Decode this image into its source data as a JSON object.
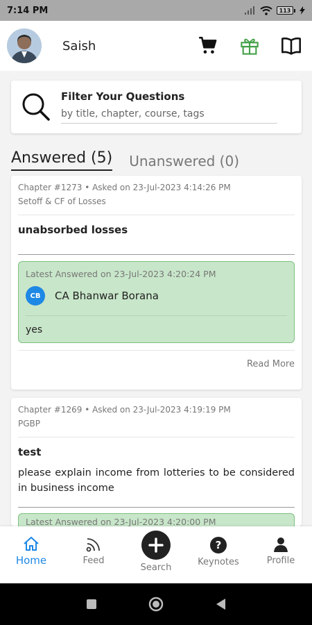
{
  "status": {
    "time": "7:14 PM",
    "battery": "113"
  },
  "header": {
    "username": "Saish"
  },
  "filter": {
    "title": "Filter Your Questions",
    "placeholder": "by title, chapter, course, tags"
  },
  "tabs": {
    "answered": "Answered (5)",
    "unanswered": "Unanswered (0)"
  },
  "questions": [
    {
      "meta": "Chapter #1273 • Asked on 23-Jul-2023 4:14:26 PM",
      "topic": "Setoff & CF of Losses",
      "title": "unabsorbed losses",
      "body": "",
      "answer": {
        "meta": "Latest Answered on 23-Jul-2023 4:20:24 PM",
        "initials": "CB",
        "name": "CA Bhanwar Borana",
        "text": "yes"
      },
      "read_more": "Read More"
    },
    {
      "meta": "Chapter #1269 • Asked on 23-Jul-2023 4:19:19 PM",
      "topic": "PGBP",
      "title": "test",
      "body": "please explain income from lotteries to be considered in business income",
      "answer": {
        "meta": "Latest Answered on 23-Jul-2023 4:20:00 PM"
      }
    }
  ],
  "nav": {
    "home": "Home",
    "feed": "Feed",
    "search": "Search",
    "keynotes": "Keynotes",
    "profile": "Profile"
  },
  "colors": {
    "accent": "#1e88e5",
    "answer_bg": "#c8e6c9",
    "gift": "#43a047"
  }
}
